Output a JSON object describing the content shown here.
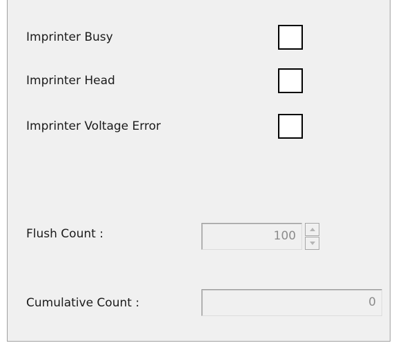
{
  "indicators": [
    {
      "label": "Imprinter Busy",
      "checked": false
    },
    {
      "label": "Imprinter Head",
      "checked": false
    },
    {
      "label": "Imprinter Voltage Error",
      "checked": false
    }
  ],
  "flush_count": {
    "label": "Flush Count :",
    "value": "100",
    "enabled": false
  },
  "cumulative_count": {
    "label": "Cumulative Count :",
    "value": "0",
    "enabled": false
  },
  "colors": {
    "panel_bg": "#f0f0f0",
    "disabled_text": "#8c8c8c",
    "box_border": "#000000"
  }
}
